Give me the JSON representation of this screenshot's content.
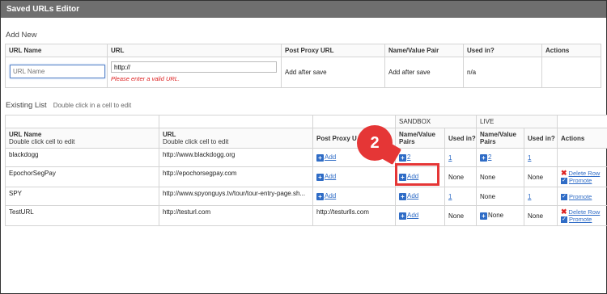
{
  "window": {
    "title": "Saved URLs Editor"
  },
  "add_new": {
    "title": "Add New",
    "columns": [
      "URL Name",
      "URL",
      "Post Proxy URL",
      "Name/Value Pair",
      "Used in?",
      "Actions"
    ],
    "url_name_placeholder": "URL Name",
    "url_value": "http://",
    "url_error": "Please enter a valid URL.",
    "post_proxy": "Add after save",
    "name_value": "Add after save",
    "used_in": "n/a"
  },
  "existing": {
    "title": "Existing List",
    "hint": "Double click in a cell to edit",
    "group_sandbox": "SANDBOX",
    "group_live": "LIVE",
    "col_url_name": "URL Name",
    "col_url_name_sub": "Double click cell to edit",
    "col_url": "URL",
    "col_url_sub": "Double click cell to edit",
    "col_post_proxy": "Post Proxy U",
    "col_nv_1": "Name/Value",
    "col_nv_2": "Pairs",
    "col_used_in": "Used in?",
    "col_actions": "Actions",
    "rows": [
      {
        "name": "blackdogg",
        "url": "http://www.blackdogg.org",
        "post_proxy": "Add",
        "sb_nv": "2",
        "sb_used": "1",
        "live_nv": "2",
        "live_used": "1",
        "delete": "",
        "promote": ""
      },
      {
        "name": "EpochorSegPay",
        "url": "http://epochorsegpay.com",
        "post_proxy": "Add",
        "sb_nv": "Add",
        "sb_used": "None",
        "live_nv": "None",
        "live_used": "None",
        "delete": "Delete Row",
        "promote": "Promote"
      },
      {
        "name": "SPY",
        "url": "http://www.spyonguys.tv/tour/tour-entry-page.sh...",
        "post_proxy": "Add",
        "sb_nv": "Add",
        "sb_used": "1",
        "live_nv": "None",
        "live_used": "1",
        "delete": "",
        "promote": "Promote"
      },
      {
        "name": "TestURL",
        "url": "http://testurl.com",
        "post_proxy": "http://testurlls.com",
        "sb_nv": "Add",
        "sb_used": "None",
        "live_nv": "None",
        "live_used": "None",
        "delete": "Delete Row",
        "promote": "Promote"
      }
    ]
  },
  "callout": {
    "number": "2"
  }
}
